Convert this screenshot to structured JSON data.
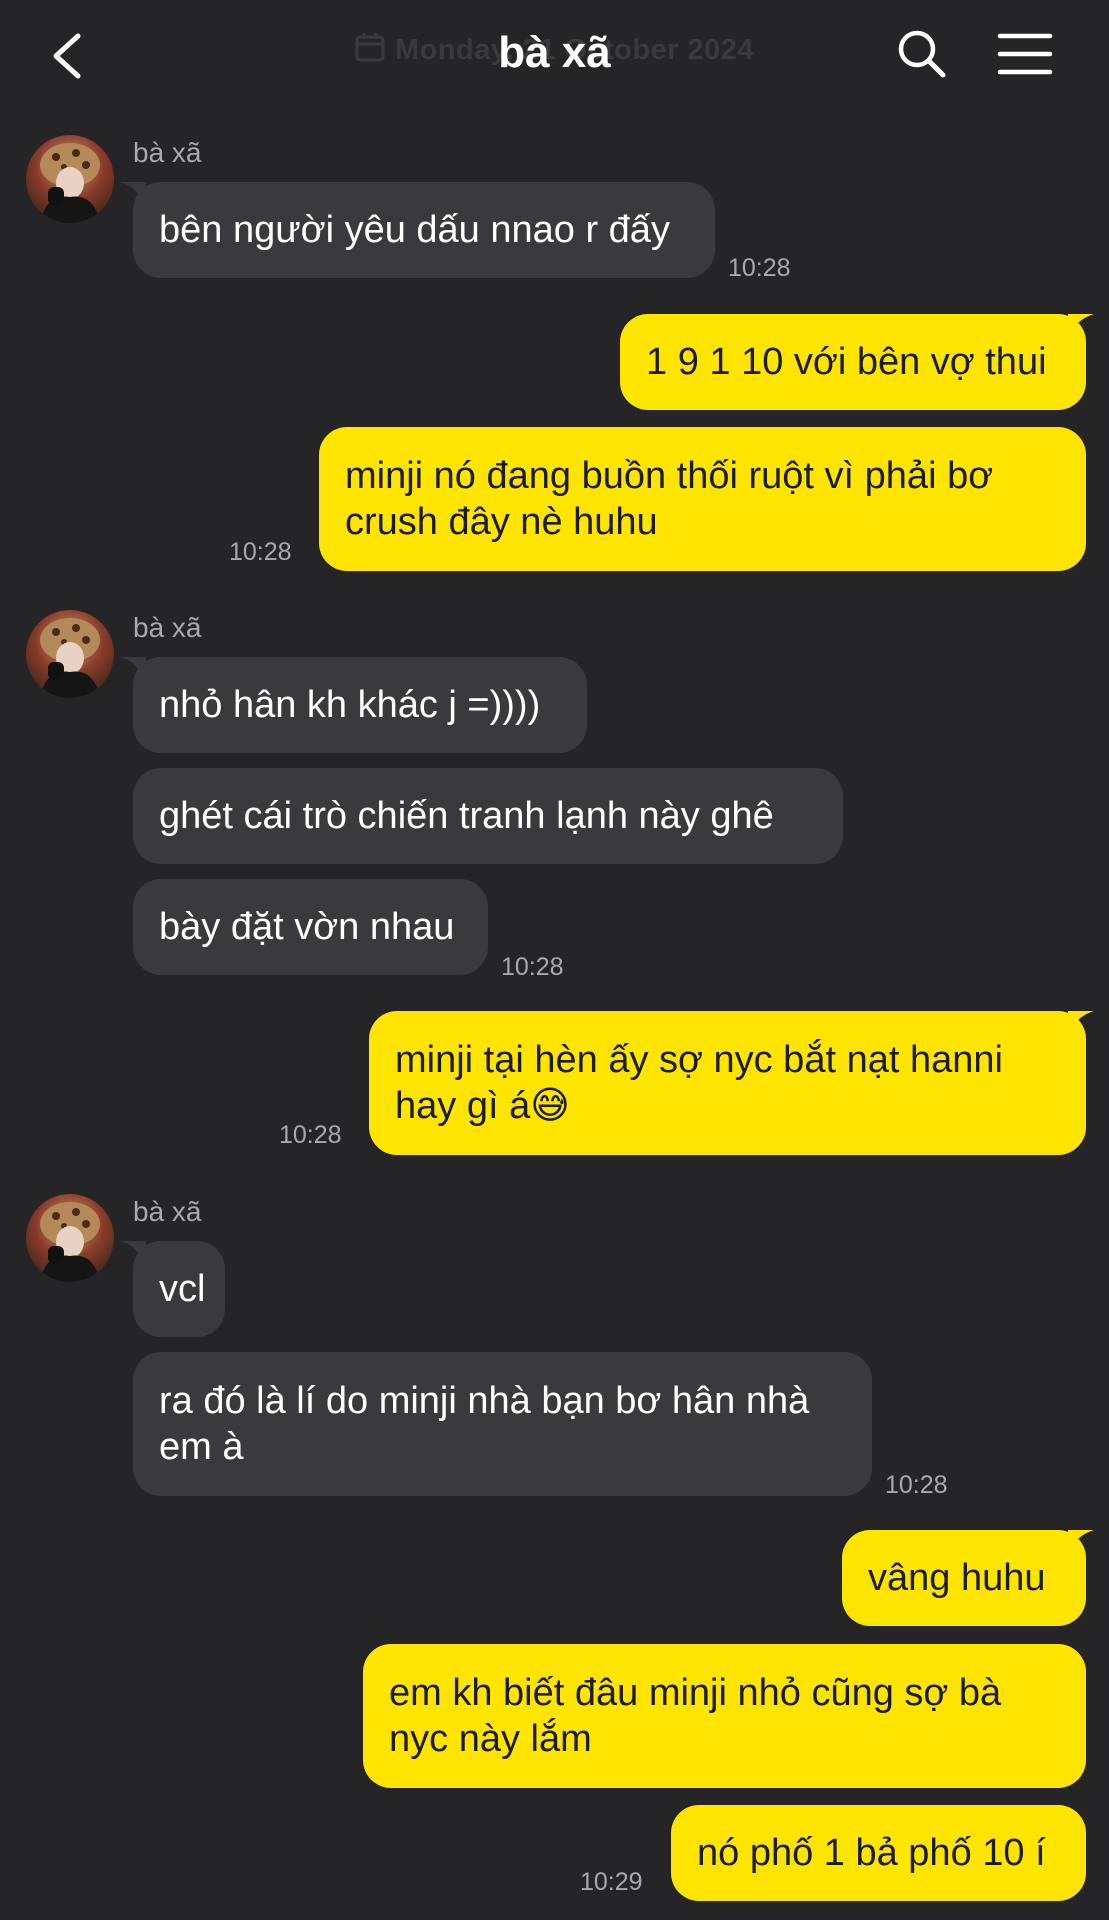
{
  "header": {
    "title": "bà xã",
    "date_overlay": "Monday, 21 October 2024",
    "back_icon": "chevron-left-icon",
    "search_icon": "search-icon",
    "menu_icon": "hamburger-menu-icon"
  },
  "colors": {
    "background": "#252528",
    "incoming_bubble": "#3a3a3e",
    "outgoing_bubble": "#fee500",
    "timestamp": "#a8a8ad"
  },
  "messages": [
    {
      "direction": "in",
      "sender": "bà xã",
      "text": "bên người yêu dấu nnao r đấy",
      "time": "10:28"
    },
    {
      "direction": "out",
      "text": "1 9 1 10 với bên vợ thui"
    },
    {
      "direction": "out",
      "text": "minji nó đang buồn thối ruột vì phải bơ crush đây nè huhu",
      "time": "10:28"
    },
    {
      "direction": "in",
      "sender": "bà xã",
      "text": "nhỏ hân kh khác j =))))"
    },
    {
      "direction": "in",
      "text": "ghét cái trò chiến tranh lạnh này ghê"
    },
    {
      "direction": "in",
      "text": "bày đặt vờn nhau",
      "time": "10:28"
    },
    {
      "direction": "out",
      "text": "minji tại hèn ấy sợ nyc bắt nạt hanni hay gì á😅",
      "time": "10:28"
    },
    {
      "direction": "in",
      "sender": "bà xã",
      "text": "vcl"
    },
    {
      "direction": "in",
      "text": "ra đó là lí do minji nhà bạn bơ hân nhà em à",
      "time": "10:28"
    },
    {
      "direction": "out",
      "text": "vâng huhu"
    },
    {
      "direction": "out",
      "text": "em kh biết đâu minji nhỏ cũng sợ bà nyc này lắm"
    },
    {
      "direction": "out",
      "text": "nó phố 1 bả phố 10 í",
      "time": "10:29"
    }
  ]
}
